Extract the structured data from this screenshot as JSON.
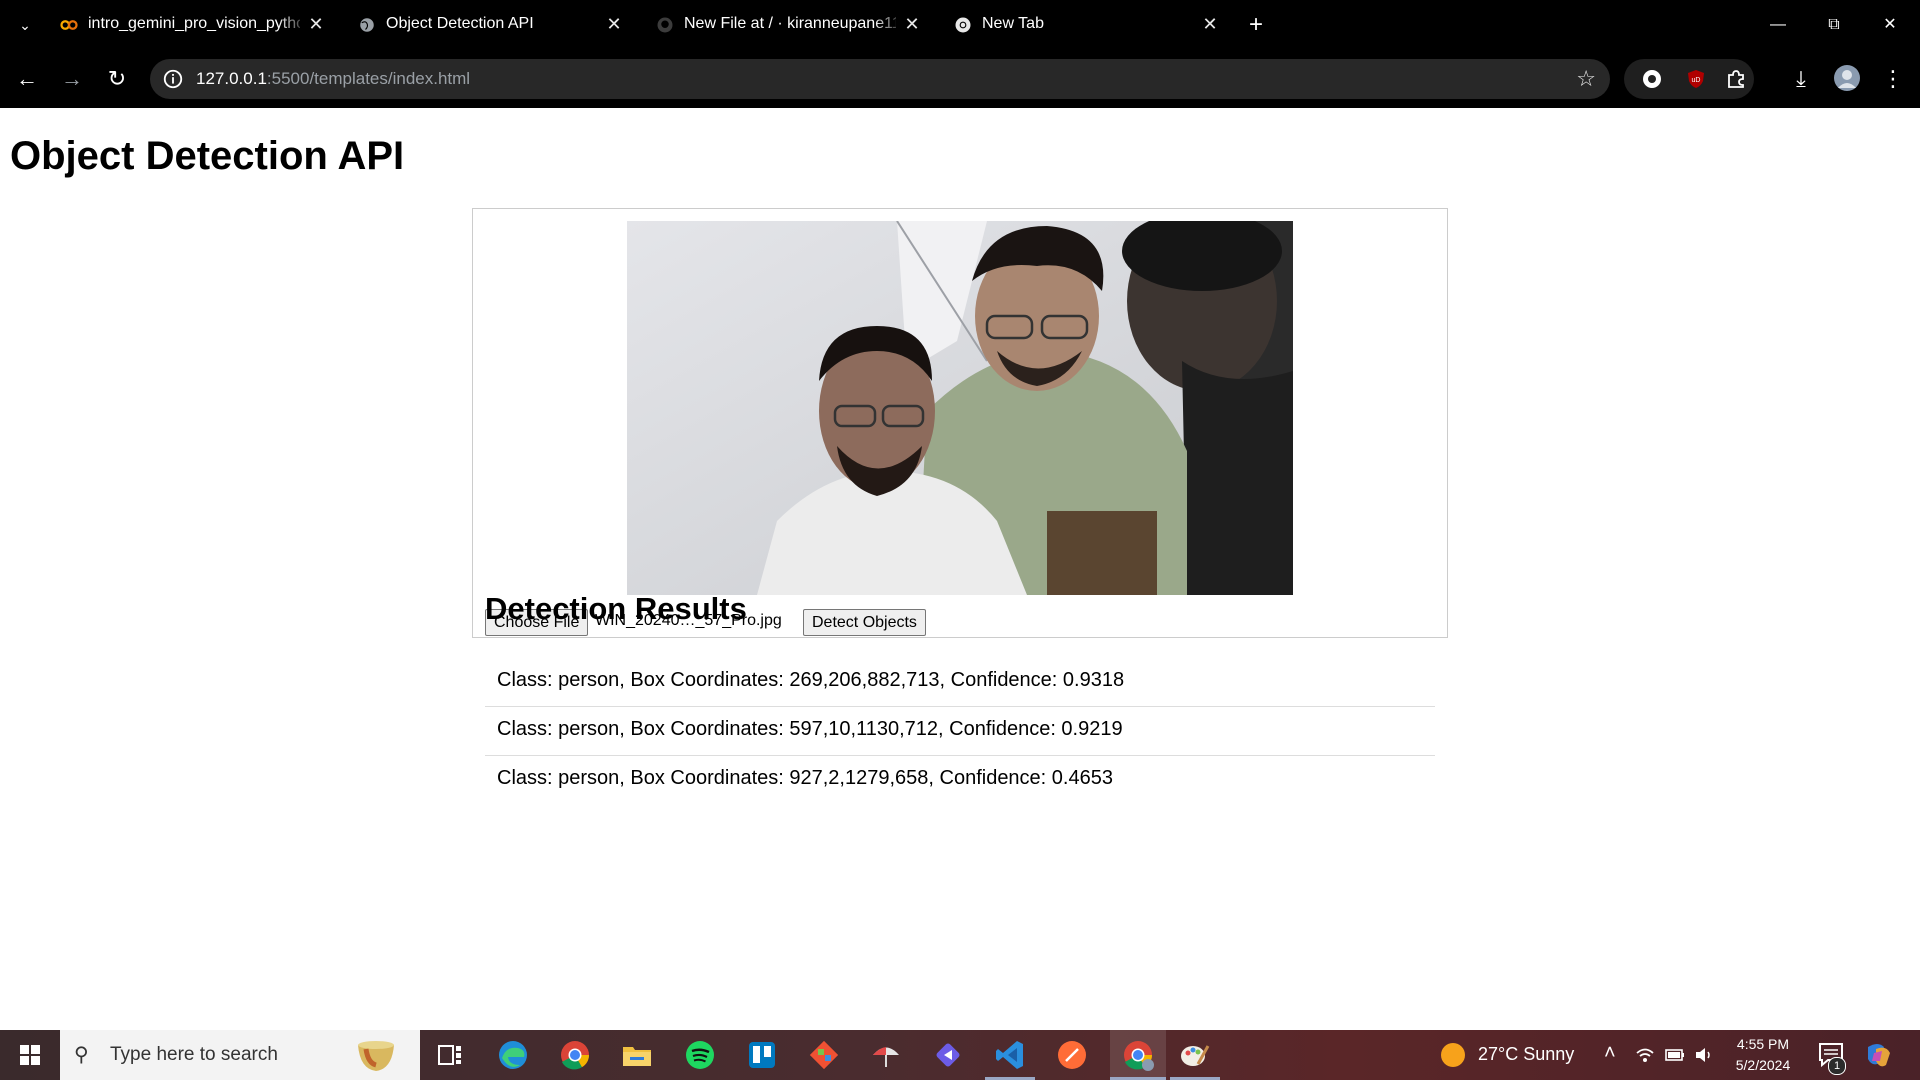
{
  "browser": {
    "tabs": [
      {
        "title": "intro_gemini_pro_vision_python",
        "favicon": "colab-icon",
        "active": false
      },
      {
        "title": "Object Detection API",
        "favicon": "globe-icon",
        "active": true
      },
      {
        "title": "New File at / · kiranneupane11/",
        "favicon": "github-icon",
        "active": false
      },
      {
        "title": "New Tab",
        "favicon": "chrome-icon",
        "active": false
      }
    ],
    "url_host": "127.0.0.1",
    "url_rest": ":5500/templates/index.html"
  },
  "page": {
    "title": "Object Detection API",
    "choose_file_label": "Choose File",
    "file_name": "WIN_20240…_57_Pro.jpg",
    "detect_button_label": "Detect Objects",
    "results_title": "Detection Results",
    "results": [
      "Class: person, Box Coordinates: 269,206,882,713, Confidence: 0.9318",
      "Class: person, Box Coordinates: 597,10,1130,712, Confidence: 0.9219",
      "Class: person, Box Coordinates: 927,2,1279,658, Confidence: 0.4653"
    ]
  },
  "taskbar": {
    "search_placeholder": "Type here to search",
    "weather": "27°C  Sunny",
    "time": "4:55 PM",
    "date": "5/2/2024",
    "notification_count": "1"
  }
}
